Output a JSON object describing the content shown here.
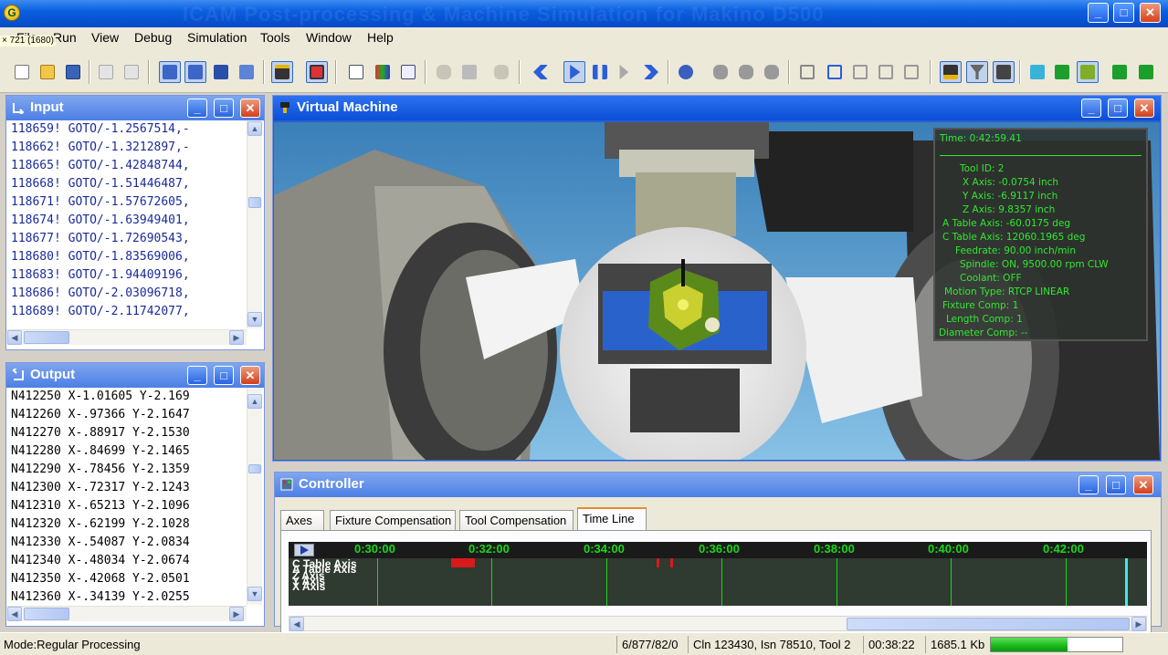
{
  "window": {
    "title": "ICAM Post-processing & Machine Simulation for Makino D500",
    "app_icon_letter": "G"
  },
  "cursor_coords": "× 721  (1680)",
  "menu": [
    "File",
    "Run",
    "View",
    "Debug",
    "Simulation",
    "Tools",
    "Window",
    "Help"
  ],
  "input_panel": {
    "title": "Input",
    "lines": [
      "118659! GOTO/-1.2567514,-",
      "118662! GOTO/-1.3212897,-",
      "118665! GOTO/-1.42848744,",
      "118668! GOTO/-1.51446487,",
      "118671! GOTO/-1.57672605,",
      "118674! GOTO/-1.63949401,",
      "118677! GOTO/-1.72690543,",
      "118680! GOTO/-1.83569006,",
      "118683! GOTO/-1.94409196,",
      "118686! GOTO/-2.03096718,",
      "118689! GOTO/-2.11742077,"
    ]
  },
  "output_panel": {
    "title": "Output",
    "lines": [
      "N412250 X-1.01605 Y-2.169",
      "N412260 X-.97366 Y-2.1647",
      "N412270 X-.88917 Y-2.1530",
      "N412280 X-.84699 Y-2.1465",
      "N412290 X-.78456 Y-2.1359",
      "N412300 X-.72317 Y-2.1243",
      "N412310 X-.65213 Y-2.1096",
      "N412320 X-.62199 Y-2.1028",
      "N412330 X-.54087 Y-2.0834",
      "N412340 X-.48034 Y-2.0674",
      "N412350 X-.42068 Y-2.0501",
      "N412360 X-.34139 Y-2.0255"
    ]
  },
  "virtual_machine": {
    "title": "Virtual Machine",
    "overlay": {
      "time": "Time:  0:42:59.41",
      "lines": [
        "Tool ID: 2",
        "X Axis: -0.0754 inch",
        "Y Axis: -6.9117 inch",
        "Z Axis: 9.8357 inch",
        "A Table Axis: -60.0175 deg",
        "C Table Axis: 12060.1965 deg",
        "Feedrate: 90.00 inch/min",
        "Spindle: ON, 9500.00 rpm CLW",
        "Coolant: OFF",
        "Motion Type: RTCP LINEAR",
        "Fixture Comp: 1",
        "Length Comp: 1",
        "Diameter Comp: --"
      ]
    }
  },
  "controller": {
    "title": "Controller",
    "tabs": [
      "Axes",
      "Fixture Compensation",
      "Tool Compensation",
      "Time Line"
    ],
    "active_tab": "Time Line",
    "timeline": {
      "ticks": [
        "0:30:00",
        "0:32:00",
        "0:34:00",
        "0:36:00",
        "0:38:00",
        "0:40:00",
        "0:42:00"
      ],
      "axes": [
        "C Table Axis",
        "A Table Axis",
        "Z Axis",
        "Y Axis",
        "X Axis"
      ]
    }
  },
  "status": {
    "mode": "Mode:Regular Processing",
    "counter": "6/877/82/0",
    "location": "Cln 123430, Isn 78510, Tool 2",
    "elapsed": "00:38:22",
    "size": "1685.1 Kb",
    "progress": 0.58
  },
  "toolbar_icons": [
    "new-file",
    "open-file",
    "save",
    "copy",
    "paste",
    "step-into",
    "step-out",
    "stop-box",
    "export",
    "machine",
    "report",
    "list",
    "chart",
    "dialog",
    "hand",
    "blocks",
    "pan",
    "rewind",
    "play",
    "pause",
    "step",
    "fast-forward",
    "inspect",
    "find",
    "find-next",
    "find-prev",
    "tree-1",
    "tree-2",
    "tree-3",
    "tree-4",
    "tree-5",
    "tool-holder",
    "tool",
    "fixture",
    "solid-1",
    "solid-2",
    "solid-3",
    "solid-4",
    "solid-5"
  ]
}
